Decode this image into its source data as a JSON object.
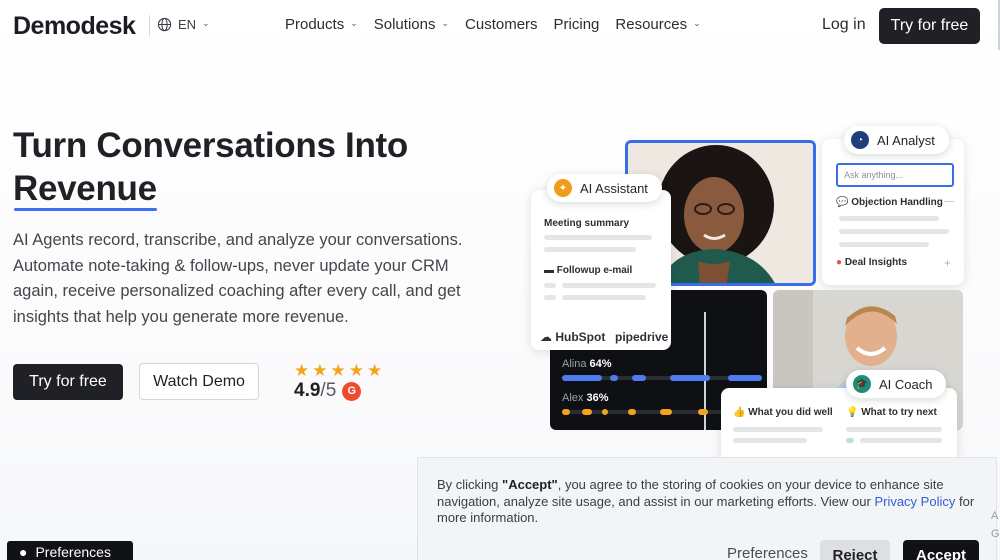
{
  "nav": {
    "logo": "Demodesk",
    "language": "EN",
    "menu": [
      {
        "label": "Products",
        "has_dropdown": true
      },
      {
        "label": "Solutions",
        "has_dropdown": true
      },
      {
        "label": "Customers",
        "has_dropdown": false
      },
      {
        "label": "Pricing",
        "has_dropdown": false
      },
      {
        "label": "Resources",
        "has_dropdown": true
      }
    ],
    "login": "Log in",
    "cta": "Try for free"
  },
  "hero": {
    "title_line1": "Turn Conversations Into",
    "title_line2": "Revenue",
    "description": "AI Agents record, transcribe, and analyze your conversations. Automate note-taking & follow-ups, never update your CRM again, receive personalized coaching after every call, and get insights that help you generate more revenue.",
    "primary_cta": "Try for free",
    "secondary_cta": "Watch Demo",
    "stars": "★★★★★",
    "rating_value": "4.9",
    "rating_outof": "/5",
    "rating_badge": "G"
  },
  "collage": {
    "ai_assistant": {
      "label": "AI Assistant",
      "meeting_summary": "Meeting summary",
      "followup_email": "Followup e-mail",
      "crm_logos": [
        "HubSpot",
        "pipedrive"
      ]
    },
    "ai_analyst": {
      "label": "AI Analyst",
      "search_placeholder": "Ask anything...",
      "objection_handling": "Objection Handling",
      "deal_insights": "Deal Insights"
    },
    "talk_ratio": [
      {
        "name": "Alina",
        "percent": "64%"
      },
      {
        "name": "Alex",
        "percent": "36%"
      }
    ],
    "ai_coach": {
      "label": "AI Coach",
      "did_well": "What you did well",
      "try_next": "What to try next"
    }
  },
  "cookie": {
    "prefix": "By clicking ",
    "accept_quoted": "\"Accept\"",
    "body": ", you agree to the storing of cookies on your device to enhance site navigation, analyze site usage, and assist in our marketing efforts. View our ",
    "privacy_link": "Privacy Policy",
    "suffix": " for more information.",
    "preferences": "Preferences",
    "reject": "Reject",
    "accept": "Accept"
  },
  "floating_preferences": "Preferences",
  "edge_chars": [
    "A",
    "G"
  ],
  "colors": {
    "accent_blue": "#3a6ee8",
    "dark": "#1f2126",
    "star": "#f2a51c",
    "g2_red": "#ef4b2f",
    "talk_blue": "#4c7cf0",
    "talk_orange": "#f2a51c"
  }
}
